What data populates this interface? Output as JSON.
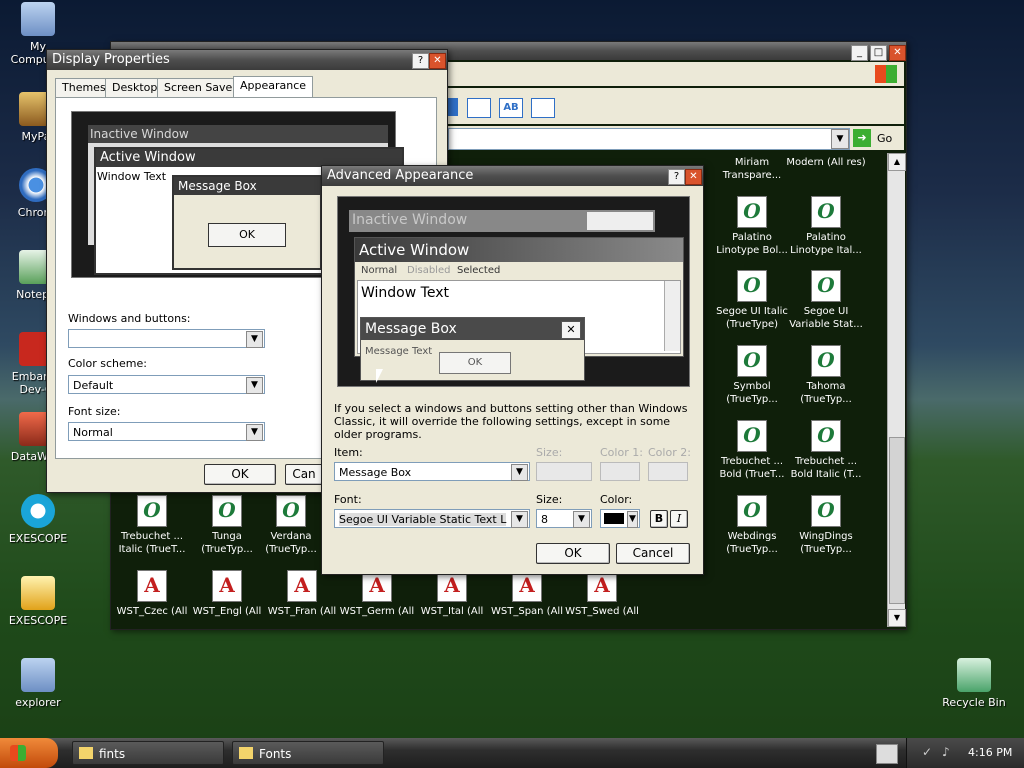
{
  "desktop": {
    "icons": [
      {
        "label": "My Computer"
      },
      {
        "label": "MyPa"
      },
      {
        "label": "Chrom"
      },
      {
        "label": "Notepa"
      },
      {
        "label": "Embarca Dev-C"
      },
      {
        "label": "DataWag"
      },
      {
        "label": "EXESCOPE"
      },
      {
        "label": "EXESCOPE"
      },
      {
        "label": "explorer"
      },
      {
        "label": "Recycle Bin"
      }
    ]
  },
  "fonts_window": {
    "go_label": "Go",
    "fonts_right": [
      {
        "label": "Miriam Transpare..."
      },
      {
        "label": "Modern (All res)"
      },
      {
        "label": "Palatino Linotype Bol..."
      },
      {
        "label": "Palatino Linotype Ital..."
      },
      {
        "label": "Segoe UI Italic (TrueType)"
      },
      {
        "label": "Segoe UI Variable Stat..."
      },
      {
        "label": "Symbol (TrueTyp..."
      },
      {
        "label": "Tahoma (TrueTyp..."
      },
      {
        "label": "Trebuchet ... Bold (TrueT..."
      },
      {
        "label": "Trebuchet ... Bold Italic (T..."
      },
      {
        "label": "Webdings (TrueTyp..."
      },
      {
        "label": "WingDings (TrueTyp..."
      }
    ],
    "fonts_bottom_row1": [
      {
        "label": "Trebuchet ... Italic (TrueT..."
      },
      {
        "label": "Tunga (TrueTyp..."
      },
      {
        "label": "Verdana (TrueTyp..."
      }
    ],
    "fonts_bottom_row2": [
      {
        "label": "WST_Czec (All"
      },
      {
        "label": "WST_Engl (All"
      },
      {
        "label": "WST_Fran (All"
      },
      {
        "label": "WST_Germ (All"
      },
      {
        "label": "WST_Ital (All"
      },
      {
        "label": "WST_Span (All"
      },
      {
        "label": "WST_Swed (All"
      }
    ]
  },
  "display_properties": {
    "title": "Display Properties",
    "tabs": [
      "Themes",
      "Desktop",
      "Screen Saver",
      "Appearance"
    ],
    "preview": {
      "inactive_title": "Inactive Window",
      "active_title": "Active Window",
      "window_text": "Window Text",
      "msgbox_title": "Message Box",
      "ok": "OK"
    },
    "windows_buttons_label": "Windows and buttons:",
    "windows_buttons_value": "",
    "color_scheme_label": "Color scheme:",
    "color_scheme_value": "Default",
    "font_size_label": "Font size:",
    "font_size_value": "Normal",
    "ok": "OK",
    "cancel": "Can"
  },
  "advanced": {
    "title": "Advanced Appearance",
    "preview": {
      "inactive_title": "Inactive Window",
      "active_title": "Active Window",
      "menu_normal": "Normal",
      "menu_disabled": "Disabled",
      "menu_selected": "Selected",
      "window_text": "Window Text",
      "msgbox_title": "Message Box",
      "msgbox_text": "Message Text",
      "ok": "OK"
    },
    "info": "If you select a windows and buttons setting other than Windows Classic, it will override the following settings, except in some older programs.",
    "item_label": "Item:",
    "item_value": "Message Box",
    "size_label": "Size:",
    "color1_label": "Color 1:",
    "color2_label": "Color 2:",
    "font_label": "Font:",
    "font_value": "Segoe UI Variable Static Text L",
    "size2_label": "Size:",
    "size2_value": "8",
    "color_label": "Color:",
    "bold": "B",
    "italic": "I",
    "ok": "OK",
    "cancel": "Cancel"
  },
  "taskbar": {
    "items": [
      "fints",
      "Fonts"
    ],
    "clock": "4:16 PM"
  }
}
